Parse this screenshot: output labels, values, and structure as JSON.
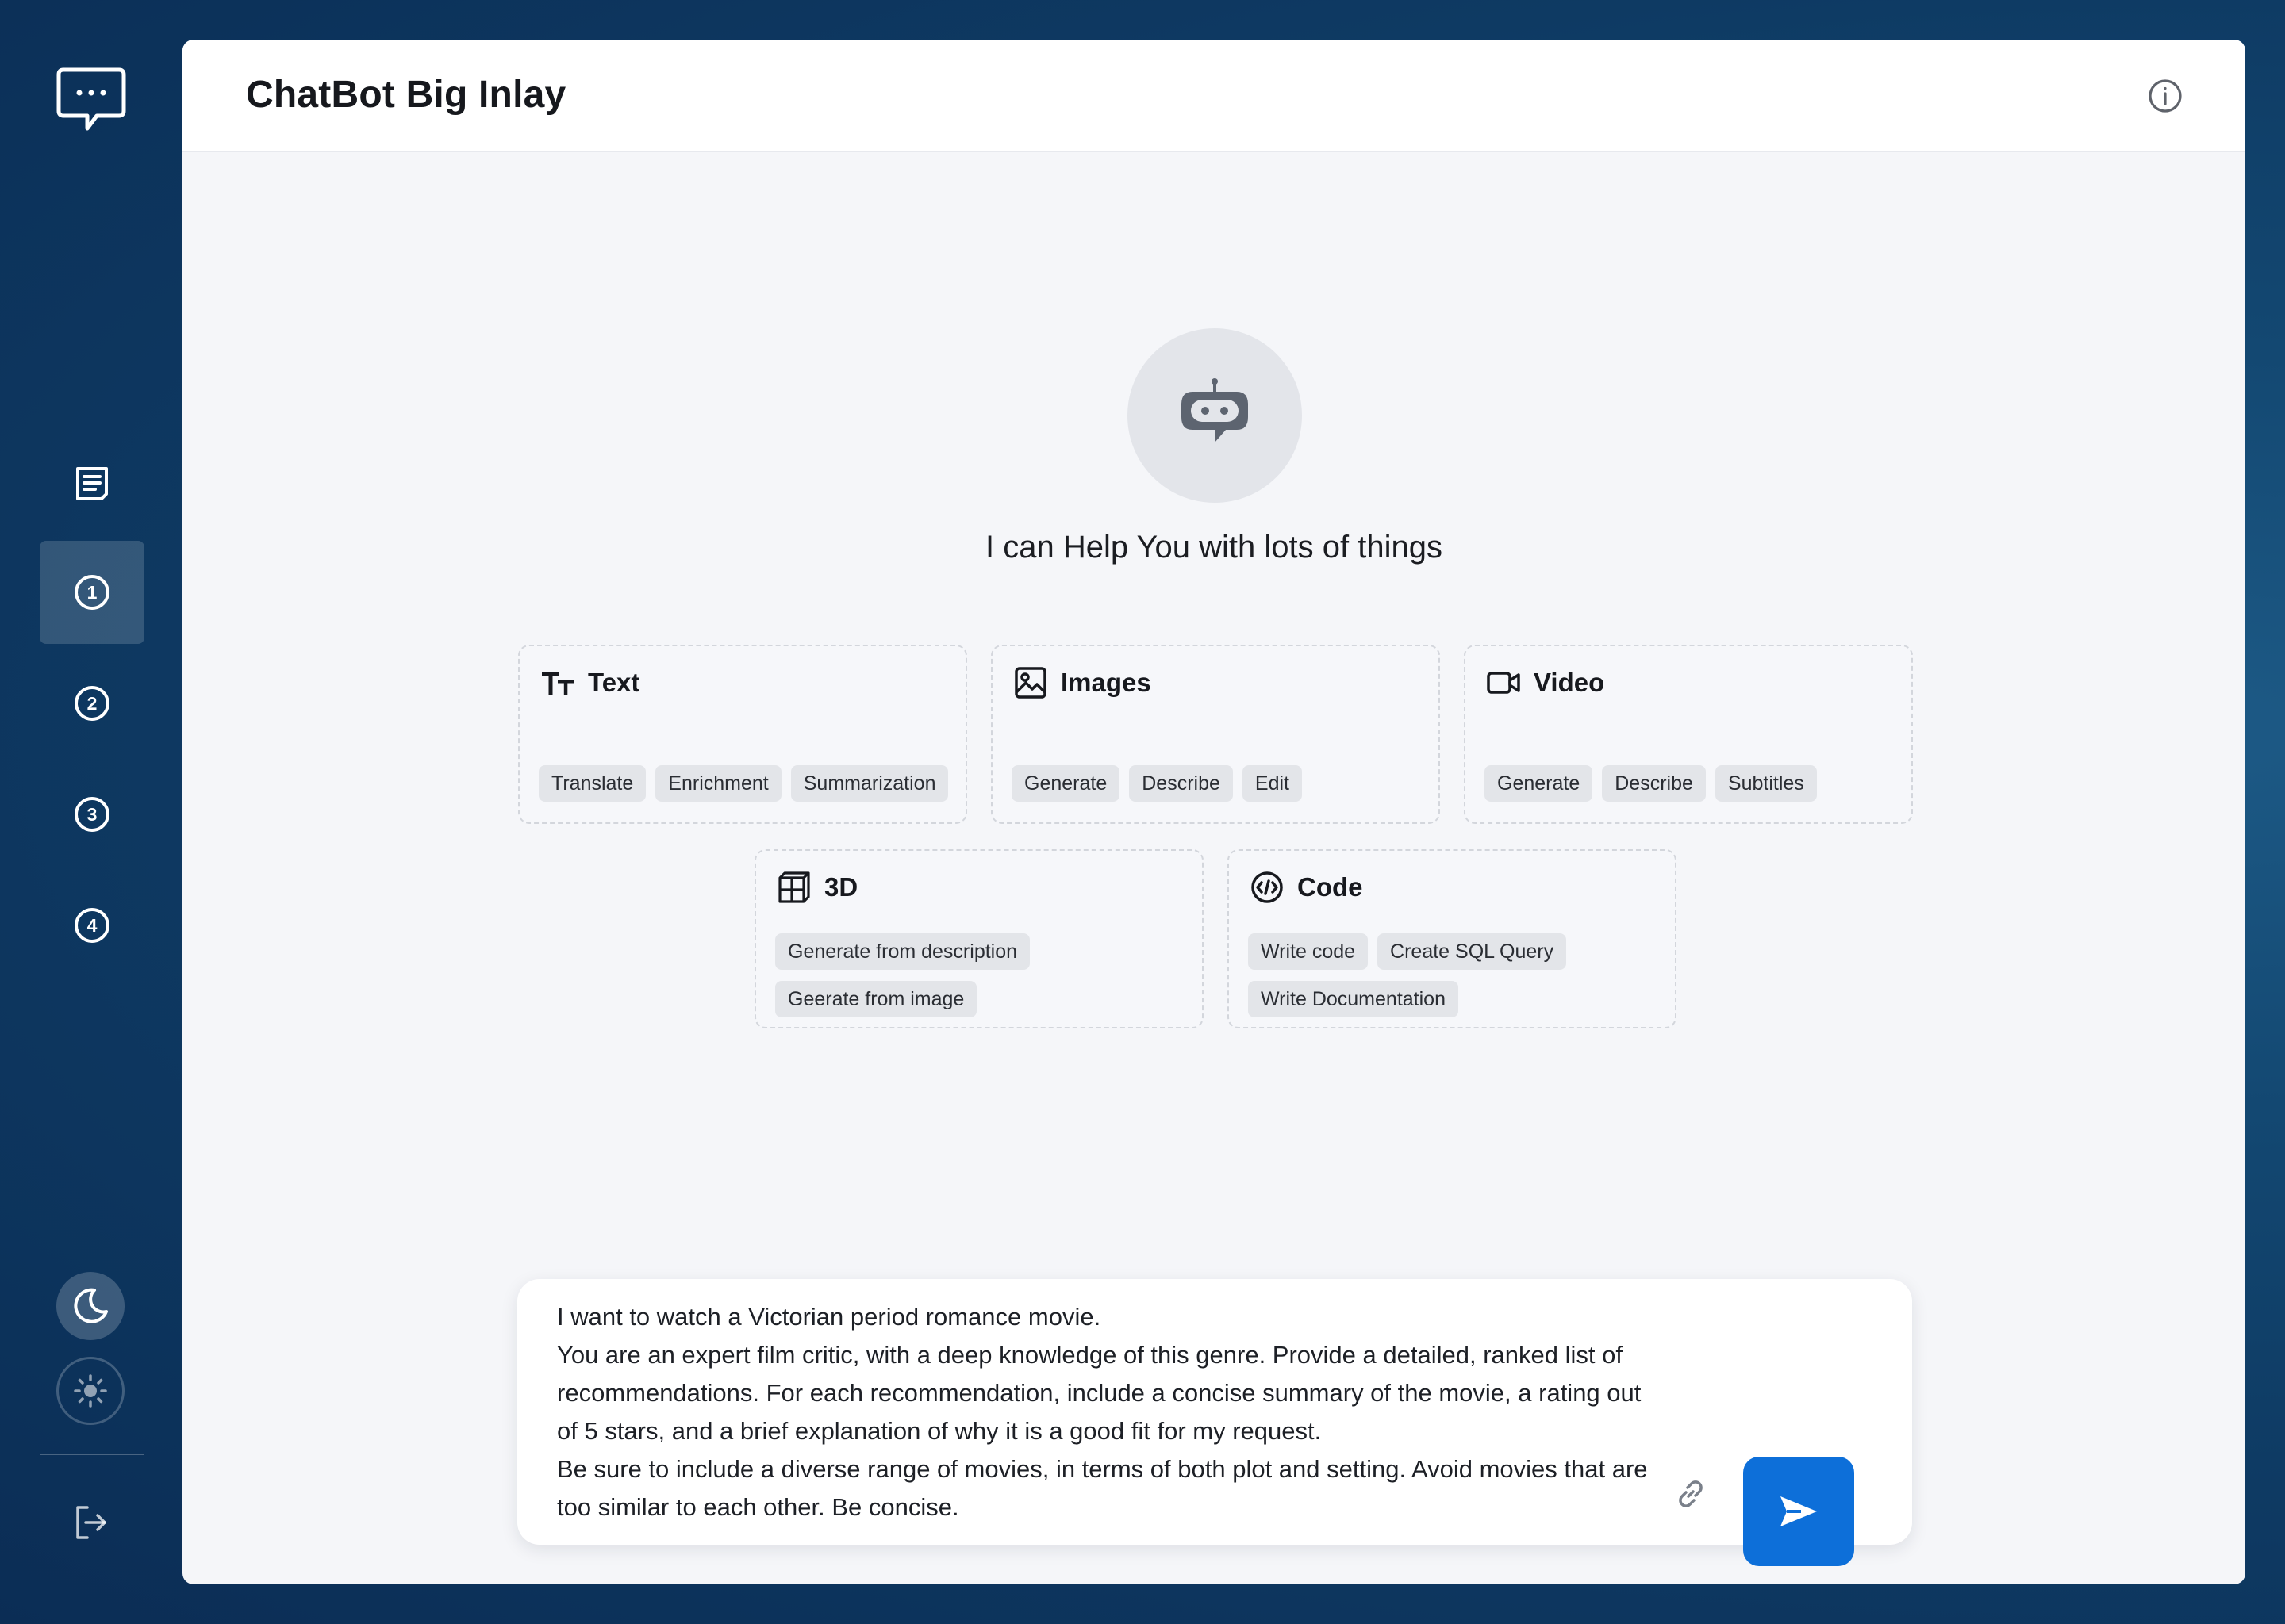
{
  "app": {
    "title": "ChatBot Big Inlay"
  },
  "sidebar": {
    "items": [
      {
        "label": "1"
      },
      {
        "label": "2"
      },
      {
        "label": "3"
      },
      {
        "label": "4"
      }
    ],
    "active_index": 0
  },
  "welcome": {
    "message": "I can Help You with lots of things"
  },
  "categories": [
    {
      "title": "Text",
      "icon": "text-size-icon",
      "chips": [
        "Translate",
        "Enrichment",
        "Summarization"
      ]
    },
    {
      "title": "Images",
      "icon": "image-icon",
      "chips": [
        "Generate",
        "Describe",
        "Edit"
      ]
    },
    {
      "title": "Video",
      "icon": "video-camera-icon",
      "chips": [
        "Generate",
        "Describe",
        "Subtitles"
      ]
    },
    {
      "title": "3D",
      "icon": "cube-icon",
      "chips": [
        "Generate from description",
        "Geerate from image"
      ]
    },
    {
      "title": "Code",
      "icon": "code-icon",
      "chips": [
        "Write code",
        "Create SQL Query",
        "Write Documentation"
      ]
    }
  ],
  "composer": {
    "value": "I want to watch a Victorian period romance movie.\nYou are an expert film critic, with a deep knowledge of this genre. Provide a detailed, ranked list of recommendations. For each recommendation, include a concise summary of the movie, a rating out of 5 stars, and a brief explanation of why it is a good fit for my request.\nBe sure to include a diverse range of movies, in terms of both plot and setting. Avoid movies that are too similar to each other. Be concise."
  },
  "colors": {
    "accent": "#0d6fd9",
    "panel_bg": "#f5f6f9",
    "chip_bg": "#e3e5e9"
  }
}
